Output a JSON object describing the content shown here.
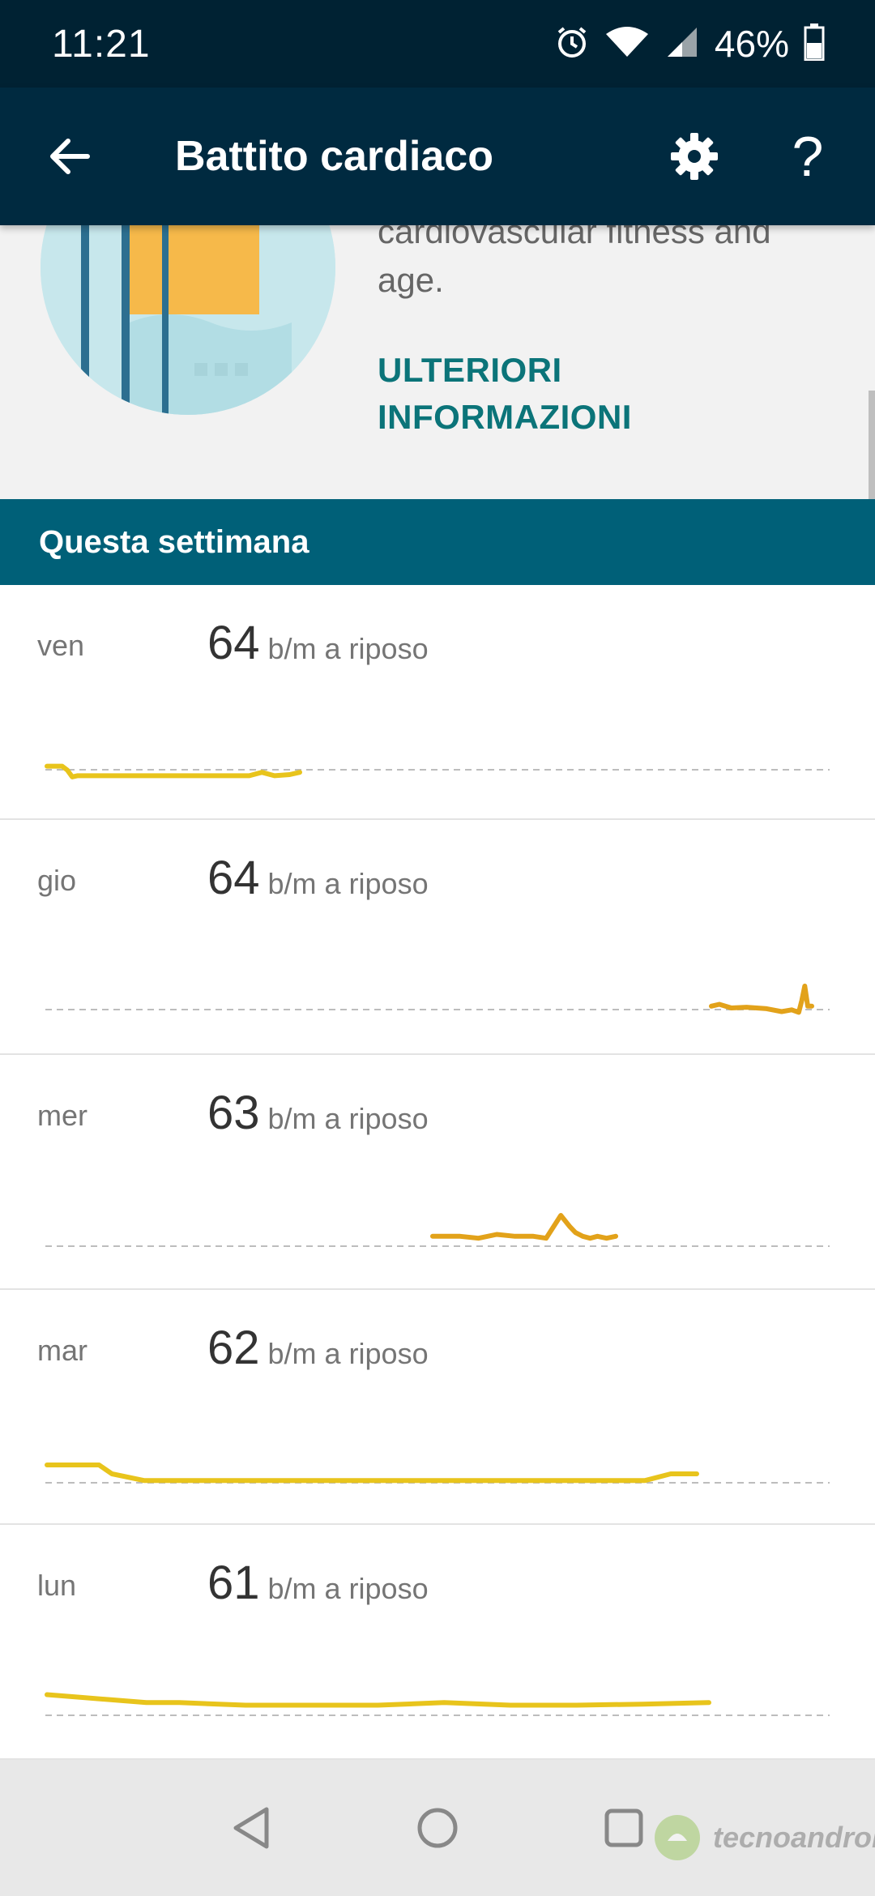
{
  "status_bar": {
    "time": "11:21",
    "battery_percent": "46%",
    "icons": [
      "alarm-icon",
      "wifi-icon",
      "signal-icon",
      "battery-icon"
    ]
  },
  "app_bar": {
    "title": "Battito cardiaco",
    "back_icon": "arrow-left-icon",
    "settings_icon": "gear-icon",
    "help_label": "?"
  },
  "info": {
    "line1": "cardiovascular fitness and",
    "line2": "age.",
    "learn_more_line1": "ULTERIORI",
    "learn_more_line2": "INFORMAZIONI"
  },
  "week": {
    "header": "Questa settimana",
    "unit": "b/m a riposo",
    "days": [
      {
        "label": "ven",
        "value": "64",
        "color": "#e8c41c",
        "trace": [
          [
            0.0,
            0.13
          ],
          [
            0.06,
            0.13
          ],
          [
            0.08,
            0.3
          ],
          [
            0.1,
            0.6
          ],
          [
            0.12,
            0.55
          ],
          [
            0.2,
            0.55
          ],
          [
            0.3,
            0.55
          ],
          [
            0.4,
            0.55
          ],
          [
            0.5,
            0.55
          ],
          [
            0.6,
            0.55
          ],
          [
            0.7,
            0.55
          ],
          [
            0.8,
            0.55
          ],
          [
            0.85,
            0.4
          ],
          [
            0.9,
            0.55
          ],
          [
            0.96,
            0.5
          ],
          [
            1.0,
            0.4
          ]
        ]
      },
      {
        "label": "gio",
        "value": "64",
        "color": "#e2a21a",
        "trace": [
          [
            0.0,
            0.55
          ],
          [
            0.08,
            0.5
          ],
          [
            0.2,
            0.6
          ],
          [
            0.35,
            0.58
          ],
          [
            0.55,
            0.62
          ],
          [
            0.7,
            0.7
          ],
          [
            0.8,
            0.65
          ],
          [
            0.87,
            0.72
          ],
          [
            0.9,
            0.4
          ],
          [
            0.93,
            0.0
          ],
          [
            0.96,
            0.55
          ],
          [
            1.0,
            0.55
          ]
        ]
      },
      {
        "label": "mer",
        "value": "63",
        "color": "#e2a21a",
        "trace": [
          [
            0.0,
            0.55
          ],
          [
            0.15,
            0.55
          ],
          [
            0.25,
            0.6
          ],
          [
            0.35,
            0.5
          ],
          [
            0.45,
            0.55
          ],
          [
            0.55,
            0.55
          ],
          [
            0.62,
            0.6
          ],
          [
            0.7,
            0.0
          ],
          [
            0.75,
            0.3
          ],
          [
            0.78,
            0.45
          ],
          [
            0.82,
            0.55
          ],
          [
            0.86,
            0.6
          ],
          [
            0.9,
            0.55
          ],
          [
            0.95,
            0.6
          ],
          [
            1.0,
            0.55
          ]
        ]
      },
      {
        "label": "mar",
        "value": "62",
        "color": "#e8c41c",
        "trace": [
          [
            0.0,
            0.2
          ],
          [
            0.08,
            0.2
          ],
          [
            0.1,
            0.4
          ],
          [
            0.15,
            0.55
          ],
          [
            0.25,
            0.55
          ],
          [
            0.35,
            0.55
          ],
          [
            0.45,
            0.55
          ],
          [
            0.55,
            0.55
          ],
          [
            0.65,
            0.55
          ],
          [
            0.75,
            0.55
          ],
          [
            0.85,
            0.55
          ],
          [
            0.92,
            0.55
          ],
          [
            0.96,
            0.4
          ],
          [
            1.0,
            0.4
          ]
        ]
      },
      {
        "label": "lun",
        "value": "61",
        "color": "#e8c41c",
        "trace": [
          [
            0.0,
            0.3
          ],
          [
            0.05,
            0.35
          ],
          [
            0.1,
            0.4
          ],
          [
            0.15,
            0.45
          ],
          [
            0.2,
            0.45
          ],
          [
            0.3,
            0.5
          ],
          [
            0.4,
            0.5
          ],
          [
            0.5,
            0.5
          ],
          [
            0.6,
            0.45
          ],
          [
            0.7,
            0.5
          ],
          [
            0.8,
            0.5
          ],
          [
            0.9,
            0.48
          ],
          [
            1.0,
            0.45
          ]
        ]
      }
    ]
  },
  "nav_bar": {
    "icons": [
      "back-triangle-icon",
      "home-circle-icon",
      "recents-square-icon"
    ]
  },
  "watermark": {
    "text": "tecnoandroid"
  }
}
